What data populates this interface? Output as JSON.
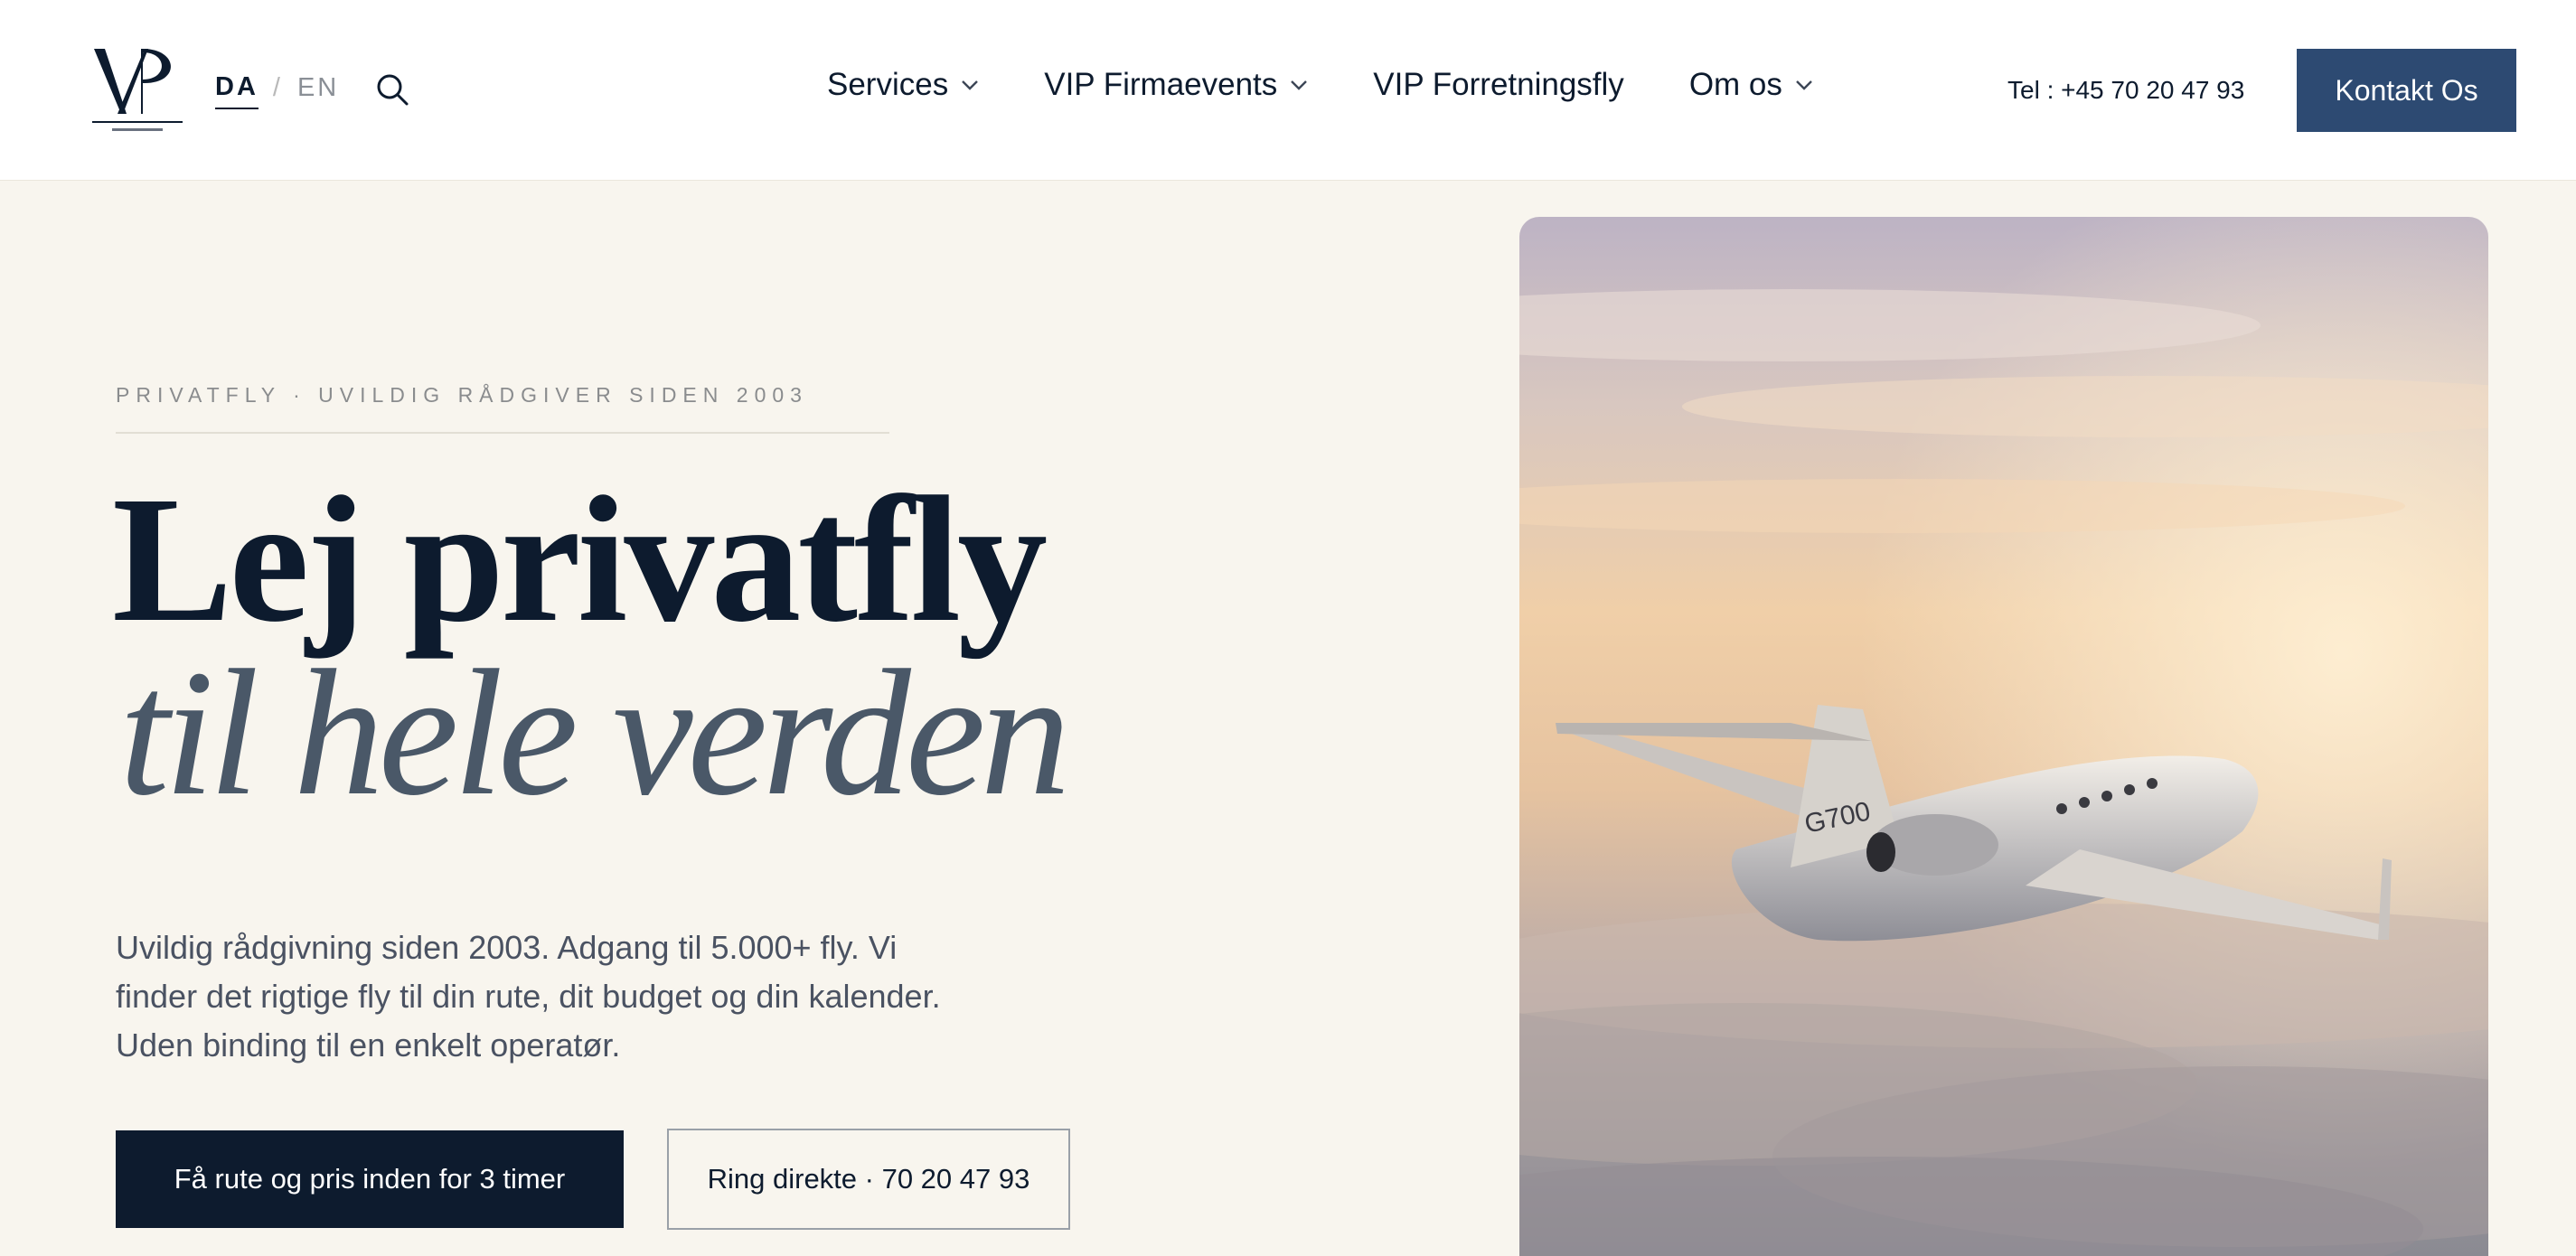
{
  "header": {
    "logo_alt": "VIP Copenhagen",
    "lang": {
      "active": "DA",
      "separator": "/",
      "other": "EN"
    },
    "nav": [
      {
        "label": "Services",
        "has_dropdown": true
      },
      {
        "label": "VIP Firmaevents",
        "has_dropdown": true
      },
      {
        "label": "VIP Forretningsfly",
        "has_dropdown": false
      },
      {
        "label": "Om os",
        "has_dropdown": true
      }
    ],
    "phone": "Tel : +45 70 20 47 93",
    "contact_button": "Kontakt Os"
  },
  "hero": {
    "eyebrow": "PRIVATFLY · UVILDIG RÅDGIVER SIDEN 2003",
    "title_line1": "Lej privatfly",
    "title_line2": "til hele verden",
    "lede": "Uvildig rådgivning siden 2003. Adgang til 5.000+ fly. Vi finder det rigtige fly til din rute, dit budget og din kalender. Uden binding til en enkelt operatør.",
    "cta_primary": "Få rute og pris inden for 3 timer",
    "cta_secondary": "Ring direkte · 70 20 47 93",
    "image_tail_text": "G700"
  },
  "colors": {
    "navy": "#0d1b2e",
    "accent_blue": "#2d4a72",
    "background": "#f8f5ee",
    "muted_slate": "#4a5868"
  }
}
